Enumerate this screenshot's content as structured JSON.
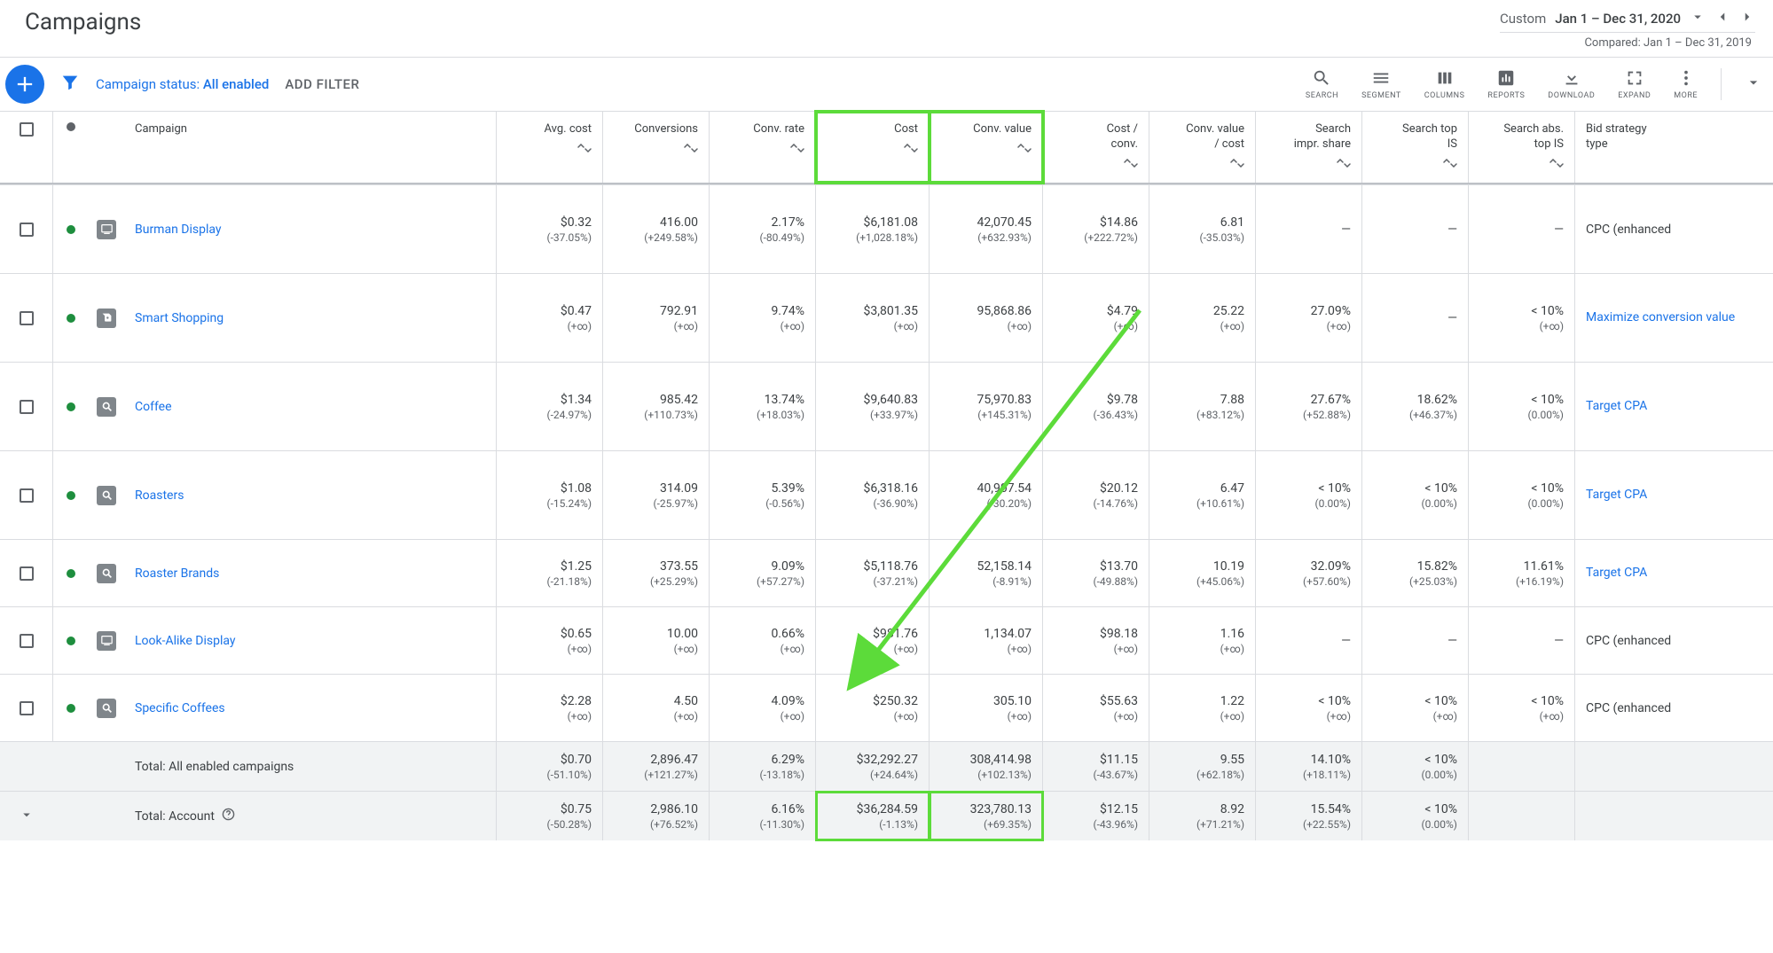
{
  "header": {
    "title": "Campaigns",
    "date_label": "Custom",
    "date_range": "Jan 1 – Dec 31, 2020",
    "compare_text": "Compared: Jan 1 – Dec 31, 2019"
  },
  "toolbar": {
    "status_prefix": "Campaign status: ",
    "status_value": "All enabled",
    "add_filter": "ADD FILTER",
    "items": [
      {
        "id": "search",
        "label": "SEARCH"
      },
      {
        "id": "segment",
        "label": "SEGMENT"
      },
      {
        "id": "columns",
        "label": "COLUMNS"
      },
      {
        "id": "reports",
        "label": "REPORTS"
      },
      {
        "id": "download",
        "label": "DOWNLOAD"
      },
      {
        "id": "expand",
        "label": "EXPAND"
      },
      {
        "id": "more",
        "label": "MORE"
      }
    ]
  },
  "columns": [
    {
      "id": "campaign",
      "label": "Campaign",
      "sortable": false
    },
    {
      "id": "avg_cost",
      "label": "Avg. cost",
      "sortable": true
    },
    {
      "id": "conversions",
      "label": "Conversions",
      "sortable": true
    },
    {
      "id": "conv_rate",
      "label": "Conv. rate",
      "sortable": true
    },
    {
      "id": "cost",
      "label": "Cost",
      "sortable": true
    },
    {
      "id": "conv_value",
      "label": "Conv. value",
      "sortable": true
    },
    {
      "id": "cost_per_conv",
      "label": "Cost /\nconv.",
      "sortable": true
    },
    {
      "id": "conv_value_cost",
      "label": "Conv. value\n/ cost",
      "sortable": true
    },
    {
      "id": "search_impr_share",
      "label": "Search\nimpr. share",
      "sortable": true
    },
    {
      "id": "search_top_is",
      "label": "Search top\nIS",
      "sortable": true
    },
    {
      "id": "search_abs_top_is",
      "label": "Search abs.\ntop IS",
      "sortable": true
    },
    {
      "id": "bid_strategy",
      "label": "Bid strategy\ntype",
      "sortable": false
    }
  ],
  "rows": [
    {
      "name": "Burman Display",
      "type": "display",
      "avg_cost": {
        "v": "$0.32",
        "d": "(-37.05%)"
      },
      "conversions": {
        "v": "416.00",
        "d": "(+249.58%)"
      },
      "conv_rate": {
        "v": "2.17%",
        "d": "(-80.49%)"
      },
      "cost": {
        "v": "$6,181.08",
        "d": "(+1,028.18%)"
      },
      "conv_value": {
        "v": "42,070.45",
        "d": "(+632.93%)"
      },
      "cost_per_conv": {
        "v": "$14.86",
        "d": "(+222.72%)"
      },
      "conv_value_cost": {
        "v": "6.81",
        "d": "(-35.03%)"
      },
      "search_impr_share": {
        "v": "—",
        "d": ""
      },
      "search_top_is": {
        "v": "—",
        "d": ""
      },
      "search_abs_top_is": {
        "v": "—",
        "d": ""
      },
      "bid_strategy": {
        "text": "CPC (enhanced",
        "link": false
      }
    },
    {
      "name": "Smart Shopping",
      "type": "shopping",
      "avg_cost": {
        "v": "$0.47",
        "d": "(+∞)"
      },
      "conversions": {
        "v": "792.91",
        "d": "(+∞)"
      },
      "conv_rate": {
        "v": "9.74%",
        "d": "(+∞)"
      },
      "cost": {
        "v": "$3,801.35",
        "d": "(+∞)"
      },
      "conv_value": {
        "v": "95,868.86",
        "d": "(+∞)"
      },
      "cost_per_conv": {
        "v": "$4.79",
        "d": "(+∞)"
      },
      "conv_value_cost": {
        "v": "25.22",
        "d": "(+∞)"
      },
      "search_impr_share": {
        "v": "27.09%",
        "d": "(+∞)"
      },
      "search_top_is": {
        "v": "—",
        "d": ""
      },
      "search_abs_top_is": {
        "v": "< 10%",
        "d": "(+∞)"
      },
      "bid_strategy": {
        "text": "Maximize conversion value",
        "link": true
      }
    },
    {
      "name": "Coffee",
      "type": "search",
      "avg_cost": {
        "v": "$1.34",
        "d": "(-24.97%)"
      },
      "conversions": {
        "v": "985.42",
        "d": "(+110.73%)"
      },
      "conv_rate": {
        "v": "13.74%",
        "d": "(+18.03%)"
      },
      "cost": {
        "v": "$9,640.83",
        "d": "(+33.97%)"
      },
      "conv_value": {
        "v": "75,970.83",
        "d": "(+145.31%)"
      },
      "cost_per_conv": {
        "v": "$9.78",
        "d": "(-36.43%)"
      },
      "conv_value_cost": {
        "v": "7.88",
        "d": "(+83.12%)"
      },
      "search_impr_share": {
        "v": "27.67%",
        "d": "(+52.88%)"
      },
      "search_top_is": {
        "v": "18.62%",
        "d": "(+46.37%)"
      },
      "search_abs_top_is": {
        "v": "< 10%",
        "d": "(0.00%)"
      },
      "bid_strategy": {
        "text": "Target CPA",
        "link": true
      }
    },
    {
      "name": "Roasters",
      "type": "search",
      "avg_cost": {
        "v": "$1.08",
        "d": "(-15.24%)"
      },
      "conversions": {
        "v": "314.09",
        "d": "(-25.97%)"
      },
      "conv_rate": {
        "v": "5.39%",
        "d": "(-0.56%)"
      },
      "cost": {
        "v": "$6,318.16",
        "d": "(-36.90%)"
      },
      "conv_value": {
        "v": "40,907.54",
        "d": "(-30.20%)"
      },
      "cost_per_conv": {
        "v": "$20.12",
        "d": "(-14.76%)"
      },
      "conv_value_cost": {
        "v": "6.47",
        "d": "(+10.61%)"
      },
      "search_impr_share": {
        "v": "< 10%",
        "d": "(0.00%)"
      },
      "search_top_is": {
        "v": "< 10%",
        "d": "(0.00%)"
      },
      "search_abs_top_is": {
        "v": "< 10%",
        "d": "(0.00%)"
      },
      "bid_strategy": {
        "text": "Target CPA",
        "link": true
      }
    },
    {
      "name": "Roaster Brands",
      "type": "search",
      "avg_cost": {
        "v": "$1.25",
        "d": "(-21.18%)"
      },
      "conversions": {
        "v": "373.55",
        "d": "(+25.29%)"
      },
      "conv_rate": {
        "v": "9.09%",
        "d": "(+57.27%)"
      },
      "cost": {
        "v": "$5,118.76",
        "d": "(-37.21%)"
      },
      "conv_value": {
        "v": "52,158.14",
        "d": "(-8.91%)"
      },
      "cost_per_conv": {
        "v": "$13.70",
        "d": "(-49.88%)"
      },
      "conv_value_cost": {
        "v": "10.19",
        "d": "(+45.06%)"
      },
      "search_impr_share": {
        "v": "32.09%",
        "d": "(+57.60%)"
      },
      "search_top_is": {
        "v": "15.82%",
        "d": "(+25.03%)"
      },
      "search_abs_top_is": {
        "v": "11.61%",
        "d": "(+16.19%)"
      },
      "bid_strategy": {
        "text": "Target CPA",
        "link": true
      }
    },
    {
      "name": "Look-Alike Display",
      "type": "display",
      "avg_cost": {
        "v": "$0.65",
        "d": "(+∞)"
      },
      "conversions": {
        "v": "10.00",
        "d": "(+∞)"
      },
      "conv_rate": {
        "v": "0.66%",
        "d": "(+∞)"
      },
      "cost": {
        "v": "$981.76",
        "d": "(+∞)"
      },
      "conv_value": {
        "v": "1,134.07",
        "d": "(+∞)"
      },
      "cost_per_conv": {
        "v": "$98.18",
        "d": "(+∞)"
      },
      "conv_value_cost": {
        "v": "1.16",
        "d": "(+∞)"
      },
      "search_impr_share": {
        "v": "—",
        "d": ""
      },
      "search_top_is": {
        "v": "—",
        "d": ""
      },
      "search_abs_top_is": {
        "v": "—",
        "d": ""
      },
      "bid_strategy": {
        "text": "CPC (enhanced",
        "link": false
      }
    },
    {
      "name": "Specific Coffees",
      "type": "search",
      "avg_cost": {
        "v": "$2.28",
        "d": "(+∞)"
      },
      "conversions": {
        "v": "4.50",
        "d": "(+∞)"
      },
      "conv_rate": {
        "v": "4.09%",
        "d": "(+∞)"
      },
      "cost": {
        "v": "$250.32",
        "d": "(+∞)"
      },
      "conv_value": {
        "v": "305.10",
        "d": "(+∞)"
      },
      "cost_per_conv": {
        "v": "$55.63",
        "d": "(+∞)"
      },
      "conv_value_cost": {
        "v": "1.22",
        "d": "(+∞)"
      },
      "search_impr_share": {
        "v": "< 10%",
        "d": "(+∞)"
      },
      "search_top_is": {
        "v": "< 10%",
        "d": "(+∞)"
      },
      "search_abs_top_is": {
        "v": "< 10%",
        "d": "(+∞)"
      },
      "bid_strategy": {
        "text": "CPC (enhanced",
        "link": false
      }
    }
  ],
  "totals": [
    {
      "label": "Total: All enabled campaigns",
      "expandable": false,
      "help": false,
      "avg_cost": {
        "v": "$0.70",
        "d": "(-51.10%)"
      },
      "conversions": {
        "v": "2,896.47",
        "d": "(+121.27%)"
      },
      "conv_rate": {
        "v": "6.29%",
        "d": "(-13.18%)"
      },
      "cost": {
        "v": "$32,292.27",
        "d": "(+24.64%)"
      },
      "conv_value": {
        "v": "308,414.98",
        "d": "(+102.13%)"
      },
      "cost_per_conv": {
        "v": "$11.15",
        "d": "(-43.67%)"
      },
      "conv_value_cost": {
        "v": "9.55",
        "d": "(+62.18%)"
      },
      "search_impr_share": {
        "v": "14.10%",
        "d": "(+18.11%)"
      },
      "search_top_is": {
        "v": "< 10%",
        "d": "(0.00%)"
      },
      "search_abs_top_is": {
        "v": "",
        "d": ""
      },
      "bid_strategy": {
        "text": "",
        "link": false
      }
    },
    {
      "label": "Total: Account",
      "expandable": true,
      "help": true,
      "avg_cost": {
        "v": "$0.75",
        "d": "(-50.28%)"
      },
      "conversions": {
        "v": "2,986.10",
        "d": "(+76.52%)"
      },
      "conv_rate": {
        "v": "6.16%",
        "d": "(-11.30%)"
      },
      "cost": {
        "v": "$36,284.59",
        "d": "(-1.13%)"
      },
      "conv_value": {
        "v": "323,780.13",
        "d": "(+69.35%)"
      },
      "cost_per_conv": {
        "v": "$12.15",
        "d": "(-43.96%)"
      },
      "conv_value_cost": {
        "v": "8.92",
        "d": "(+71.21%)"
      },
      "search_impr_share": {
        "v": "15.54%",
        "d": "(+22.55%)"
      },
      "search_top_is": {
        "v": "< 10%",
        "d": "(0.00%)"
      },
      "search_abs_top_is": {
        "v": "",
        "d": ""
      },
      "bid_strategy": {
        "text": "",
        "link": false
      }
    }
  ]
}
